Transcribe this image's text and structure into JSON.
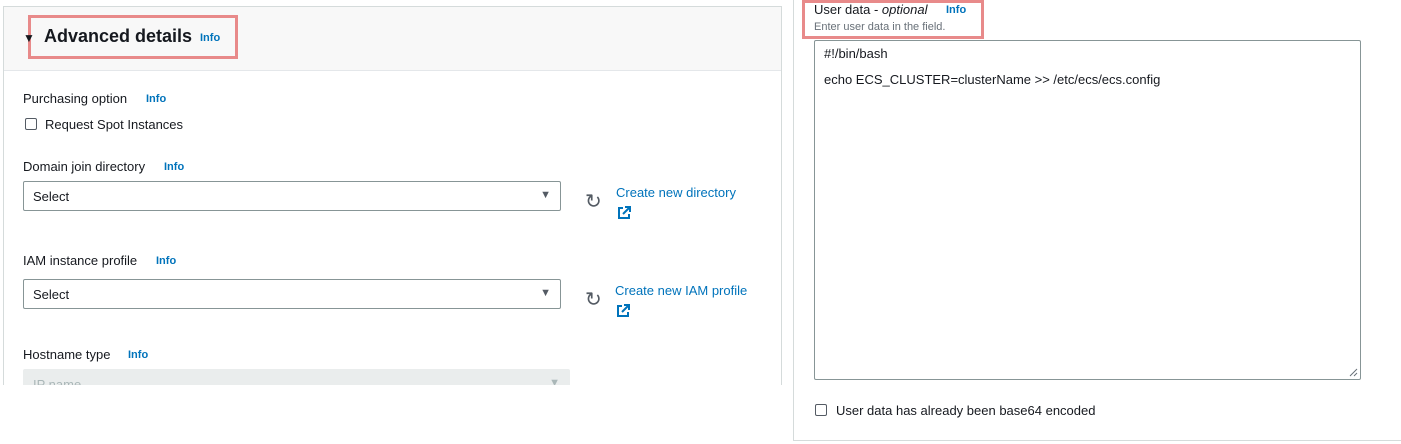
{
  "advanced": {
    "title": "Advanced details",
    "info": "Info"
  },
  "purchasing": {
    "label": "Purchasing option",
    "info": "Info",
    "checkbox_label": "Request Spot Instances"
  },
  "domain_join": {
    "label": "Domain join directory",
    "info": "Info",
    "selected": "Select",
    "create_link": "Create new directory"
  },
  "iam_profile": {
    "label": "IAM instance profile",
    "info": "Info",
    "selected": "Select",
    "create_link": "Create new IAM profile"
  },
  "hostname": {
    "label": "Hostname type",
    "info": "Info",
    "selected": "IP name"
  },
  "user_data": {
    "label": "User data - ",
    "optional": "optional",
    "info": "Info",
    "hint": "Enter user data in the field.",
    "lines": [
      "#!/bin/bash",
      "echo ECS_CLUSTER=clusterName >> /etc/ecs/ecs.config"
    ],
    "base64_label": "User data has already been base64 encoded"
  },
  "colors": {
    "link": "#0073bb",
    "highlight": "#e88a8a"
  }
}
